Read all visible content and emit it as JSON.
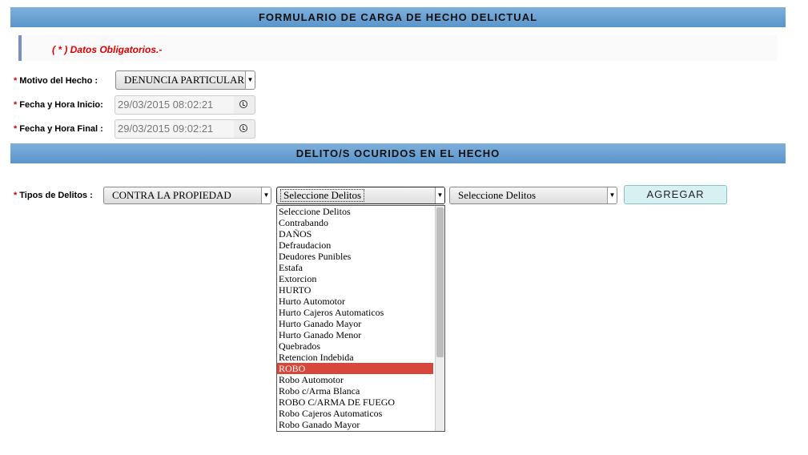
{
  "header": {
    "title": "FORMULARIO DE CARGA DE HECHO DELICTUAL"
  },
  "notice": {
    "text": "( * ) Datos Obligatorios.-"
  },
  "form": {
    "required_mark": "*",
    "motivo": {
      "label": "Motivo del Hecho :",
      "value": "DENUNCIA PARTICULAR"
    },
    "fecha_inicio": {
      "label": "Fecha y Hora Inicio:",
      "value": "29/03/2015 08:02:21"
    },
    "fecha_final": {
      "label": "Fecha y Hora Final :",
      "value": "29/03/2015 09:02:21"
    }
  },
  "section": {
    "title": "DELITO/S OCURIDOS EN EL HECHO"
  },
  "delitos": {
    "label": "Tipos de Delitos :",
    "tipo_value": "CONTRA LA PROPIEDAD",
    "delito_value": "Seleccione Delitos",
    "subdelito_value": "Seleccione Delitos",
    "add_button": "AGREGAR",
    "options": [
      "Seleccione Delitos",
      "Contrabando",
      "DAÑOS",
      "Defraudacion",
      "Deudores Punibles",
      "Estafa",
      "Extorcion",
      "HURTO",
      "Hurto Automotor",
      "Hurto Cajeros Automaticos",
      "Hurto Ganado Mayor",
      "Hurto Ganado Menor",
      "Quebrados",
      "Retencion Indebida",
      "ROBO",
      "Robo Automotor",
      "Robo c/Arma Blanca",
      "ROBO C/ARMA DE FUEGO",
      "Robo Cajeros Automaticos",
      "Robo Ganado Mayor"
    ],
    "highlighted_option": "ROBO"
  },
  "icons": {
    "dropdown": "chevron-down-icon",
    "clock": "clock-icon"
  },
  "colors": {
    "header_bar": "#6ba3d6",
    "required": "#e00000",
    "highlight": "#d9473a",
    "button_bg": "#d7f1f3"
  }
}
